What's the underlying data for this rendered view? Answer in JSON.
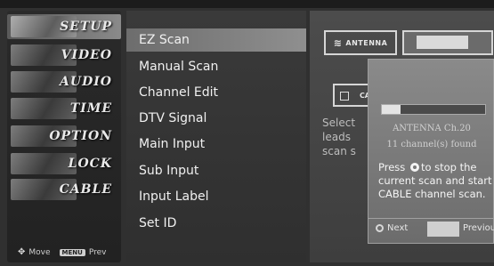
{
  "categories": [
    {
      "label": "SETUP",
      "active": true
    },
    {
      "label": "VIDEO",
      "active": false
    },
    {
      "label": "AUDIO",
      "active": false
    },
    {
      "label": "TIME",
      "active": false
    },
    {
      "label": "OPTION",
      "active": false
    },
    {
      "label": "LOCK",
      "active": false
    },
    {
      "label": "CABLE",
      "active": false
    }
  ],
  "nav_hint": {
    "move_label": "Move",
    "prev_key": "MENU",
    "prev_label": "Prev"
  },
  "menu": {
    "items": [
      {
        "label": "EZ Scan",
        "active": true
      },
      {
        "label": "Manual Scan",
        "active": false
      },
      {
        "label": "Channel Edit",
        "active": false
      },
      {
        "label": "DTV Signal",
        "active": false
      },
      {
        "label": "Main Input",
        "active": false
      },
      {
        "label": "Sub Input",
        "active": false
      },
      {
        "label": "Input Label",
        "active": false
      },
      {
        "label": "Set ID",
        "active": false
      }
    ]
  },
  "description": {
    "antenna_label": "ANTENNA",
    "cable_label": "CA",
    "text_lines": [
      "Select",
      "leads",
      "scan s"
    ]
  },
  "scan_popup": {
    "progress": 0.18,
    "channel_status": "ANTENNA Ch.20",
    "found_status": "11 channel(s) found",
    "press_before": "Press",
    "press_after": "to stop the current scan and start CABLE channel scan.",
    "next_label": "Next",
    "previous_label": "Previous"
  }
}
